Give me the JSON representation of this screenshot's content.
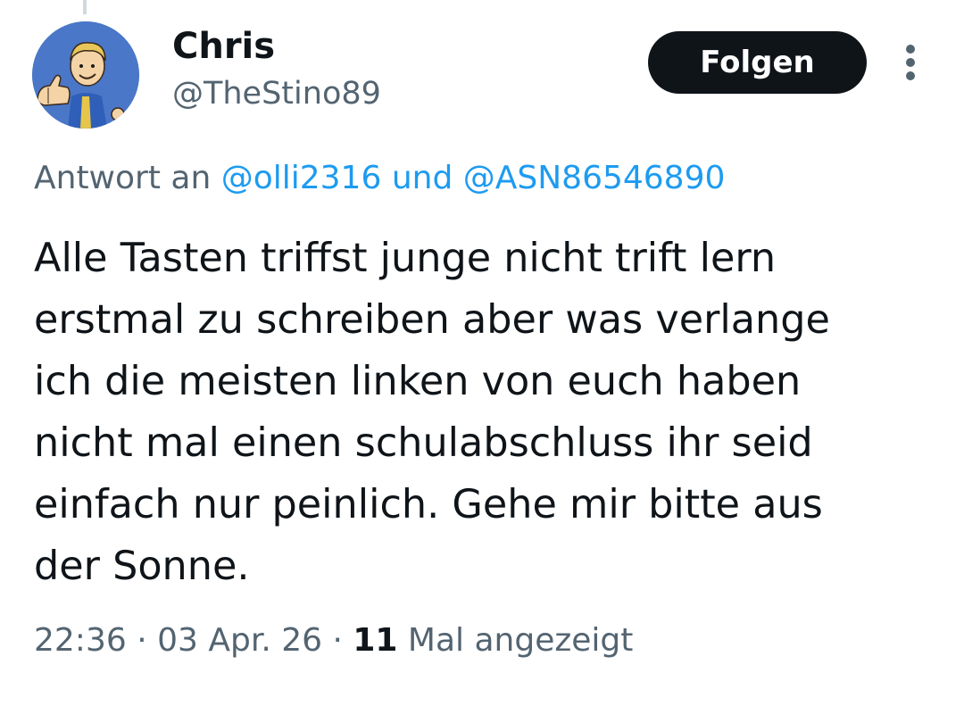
{
  "tweet": {
    "author": {
      "display_name": "Chris",
      "handle": "@TheStino89",
      "avatar_icon": "vault-boy-thumbs-up-icon"
    },
    "follow_button_label": "Folgen",
    "more_icon": "more-vertical-icon",
    "reply_to": {
      "prefix": "Antwort an ",
      "mentions": [
        "@olli2316",
        "@ASN86546890"
      ],
      "joiner": " und "
    },
    "text_lines": [
      "Alle Tasten triffst junge nicht trift lern",
      "erstmal zu schreiben aber was verlange",
      "ich die meisten linken von euch haben",
      "nicht mal einen schulabschluss ihr seid",
      "einfach nur peinlich. Gehe mir bitte aus",
      "der Sonne."
    ],
    "meta": {
      "time": "22:36",
      "separator": " · ",
      "date": "03 Apr. 26",
      "views_count": "11",
      "views_label": " Mal angezeigt"
    }
  },
  "colors": {
    "text_primary": "#0f1419",
    "text_secondary": "#536471",
    "link": "#1d9bf0",
    "button_bg": "#0f1419",
    "button_text": "#ffffff",
    "avatar_bg": "#4a77c7"
  }
}
